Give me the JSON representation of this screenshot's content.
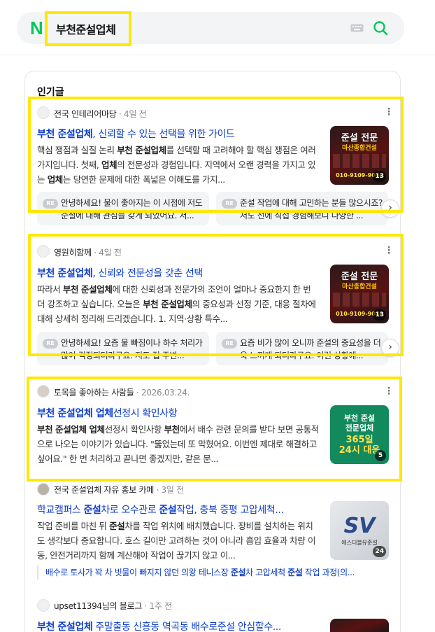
{
  "search": {
    "logo": "N",
    "query": "부천준설업체"
  },
  "section_title": "인기글",
  "posts": [
    {
      "source": "전국 인테리어마당",
      "time": "4일 전",
      "title_kw": "부천 준설업체",
      "title_rest": ", 신뢰할 수 있는 선택을 위한 가이드",
      "desc_parts": [
        "핵심 쟁점과 실질 논리 ",
        "부천 준설업체",
        "를 선택할 때 고려해야 할 핵심 쟁점은 여러 가지입니다. 첫째, ",
        "업체",
        "의 전문성과 경험입니다. 지역에서 오랜 경력을 가지고 있는 ",
        "업체",
        "는 당연한 문제에 대한 폭넓은 이해도를 가지..."
      ],
      "thumb": {
        "title": "준설 전문",
        "subtitle": "마산종합건설",
        "phone": "010-9109-9046",
        "count": "13"
      },
      "replies": [
        "안녕하세요! 물이 좋아지는 이 시점에 저도 준설에 대해 관심을 갖게 되었어요. 저...",
        "준설 작업에 대해 고민하는 분들 많으시죠? 저도 전에 직접 경험해보니 다양한 ..."
      ],
      "reply_kw": [
        "",
        "준설"
      ]
    },
    {
      "source": "영원히함께",
      "time": "4일 전",
      "title_kw": "부천 준설업체",
      "title_rest": ", 신뢰와 전문성을 갖춘 선택",
      "desc_parts": [
        "따라서 ",
        "부천 준설업체",
        "에 대한 신뢰성과 전문가의 조언이 얼마나 중요한지 한 번 더 강조하고 싶습니다. 오늘은 ",
        "부천 준설업체",
        "의 중요성과 선정 기준, 대응 절차에 대해 상세히 정리해 드리겠습니다. 1. 지역·상황 특수...",
        "",
        ""
      ],
      "thumb": {
        "title": "준설 전문",
        "subtitle": "마산종합건설",
        "phone": "010-9109-9046",
        "count": "13"
      },
      "replies": [
        "안녕하세요! 요즘 물 빠짐이나 하수 처리가 많이 걱정되더라구요. 저도 집 주변...",
        "요즘 비가 많이 오니까 준설의 중요성을 더욱 느끼게 되더라구요. 이런 상황에..."
      ]
    },
    {
      "source": "토목을 좋아하는 사람들",
      "time": "2026.03.24.",
      "title_kw": "부천 준설업체 업체",
      "title_rest": "선정시 확인사항",
      "desc_parts": [
        "",
        "부천 준설업체 업체",
        "선정시 확인사항 ",
        "부천",
        "에서 배수 관련 문의를 받다 보면 공통적으로 나오는 이야기가 있습니다. \"뚫었는데 또 막혔어요. 이번엔 제대로 해결하고 싶어요.\" 한 번 처리하고 끝나면 좋겠지만, 같은 문...",
        "",
        ""
      ],
      "thumb": {
        "line1": "부천 준설",
        "line2": "전문업체",
        "line3": "365일",
        "line4": "24시 대응",
        "count": "5"
      }
    },
    {
      "source": "전국 준설업체 자유 홍보 카페",
      "time": "3일 전",
      "title_a": "학교캠퍼스 ",
      "title_kw": "준설",
      "title_b": "차로 오수관로 ",
      "title_kw2": "준설",
      "title_c": "작업, 충북 증평 고압세척...",
      "desc_parts": [
        "작업 준비를 마친 뒤 ",
        "준설",
        "차를 작업 위치에 배치했습니다. 장비를 설치하는 위치도 생각보다 중요합니다. 호스 길이만 고려하는 것이 아니라 흡입 효율과 차량 이동, 안전거리까지 함께 계산해야 작업이 끊기지 않고 이...",
        "",
        "",
        "",
        ""
      ],
      "thumb": {
        "logo": "SV",
        "sub": "에스더블유준설",
        "count": "24"
      },
      "related": [
        "배수로 토사가 꽉 차 빗물이 빠지지 않던 의왕 테니스장 ",
        "준설",
        "차 고압세척 ",
        "준설",
        " 작업 과정(의..."
      ]
    },
    {
      "source": "upset11394님의 블로그",
      "time": "1주 전",
      "title_kw": "부천 준설업체",
      "title_rest": " 주말출동 신흥동 역곡동 배수로준설 안심할수..."
    }
  ]
}
